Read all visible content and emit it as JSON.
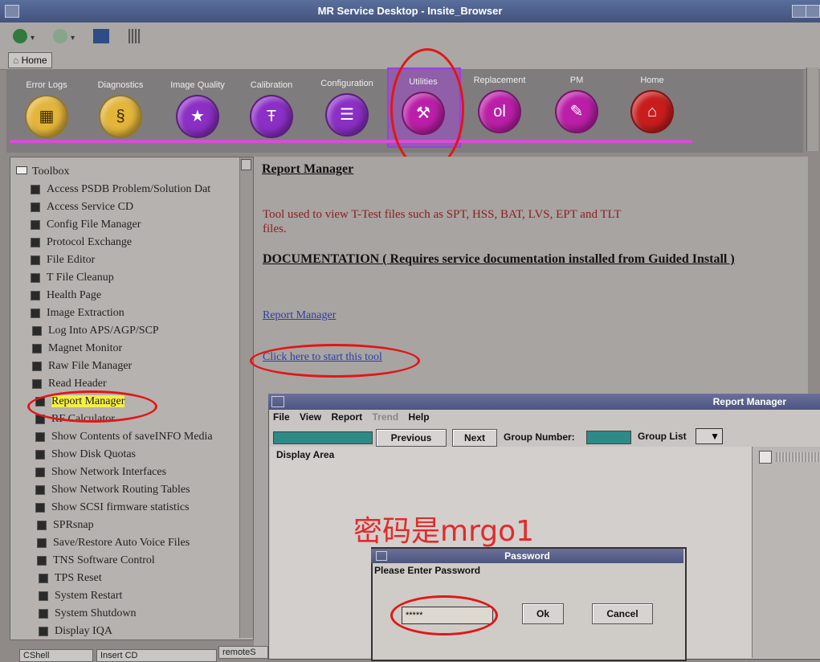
{
  "window": {
    "title": "MR Service Desktop - Insite_Browser"
  },
  "nav": {
    "home_label": "Home"
  },
  "ribbon": {
    "items": [
      {
        "label": "Error Logs",
        "glyph": "▦",
        "color": "gold"
      },
      {
        "label": "Diagnostics",
        "glyph": "§",
        "color": "gold"
      },
      {
        "label": "Image Quality",
        "glyph": "★",
        "color": "purple"
      },
      {
        "label": "Calibration",
        "glyph": "Ŧ",
        "color": "purple"
      },
      {
        "label": "Configuration",
        "glyph": "☰",
        "color": "purple"
      },
      {
        "label": "Utilities",
        "glyph": "⚒",
        "color": "magenta"
      },
      {
        "label": "Replacement",
        "glyph": "ol",
        "color": "magenta"
      },
      {
        "label": "PM",
        "glyph": "✎",
        "color": "magenta"
      },
      {
        "label": "Home",
        "glyph": "⌂",
        "color": "red"
      }
    ]
  },
  "toolbox": {
    "root": "Toolbox",
    "items": [
      "Access PSDB Problem/Solution Dat",
      "Access Service CD",
      "Config File Manager",
      "Protocol Exchange",
      "File Editor",
      "T File Cleanup",
      "Health Page",
      "Image Extraction",
      "Log Into APS/AGP/SCP",
      "Magnet Monitor",
      "Raw File Manager",
      "Read Header",
      "Report Manager",
      "RF Calculator",
      "Show Contents of saveINFO Media",
      "Show Disk Quotas",
      "Show Network Interfaces",
      "Show Network Routing Tables",
      "Show SCSI firmware statistics",
      "SPRsnap",
      "Save/Restore Auto Voice Files",
      "TNS Software Control",
      "TPS Reset",
      "System Restart",
      "System Shutdown",
      "Display IQA"
    ],
    "selected": "Report Manager"
  },
  "content": {
    "title": "Report Manager",
    "description": "Tool used to view T-Test files such as SPT, HSS, BAT, LVS, EPT and TLT files.",
    "doc_heading": "DOCUMENTATION ( Requires service documentation installed from Guided Install )",
    "doc_link": "Report Manager",
    "start_link": "Click here to start this tool"
  },
  "report_manager": {
    "title": "Report Manager",
    "menu": [
      "File",
      "View",
      "Report",
      "Trend",
      "Help"
    ],
    "previous": "Previous",
    "next": "Next",
    "group_number_label": "Group Number:",
    "group_list_label": "Group List",
    "display_area_label": "Display Area"
  },
  "password_dialog": {
    "title": "Password",
    "prompt": "Please Enter Password",
    "value": "*****",
    "ok": "Ok",
    "cancel": "Cancel"
  },
  "annotation": {
    "text": "密码是mrgo1"
  },
  "bottom_tabs": [
    "CShell",
    "Insert CD",
    "remoteS"
  ],
  "colors": {
    "highlight": "#f3ef46",
    "annotation_red": "#e21616",
    "ribbon_line": "#d44fd4"
  }
}
